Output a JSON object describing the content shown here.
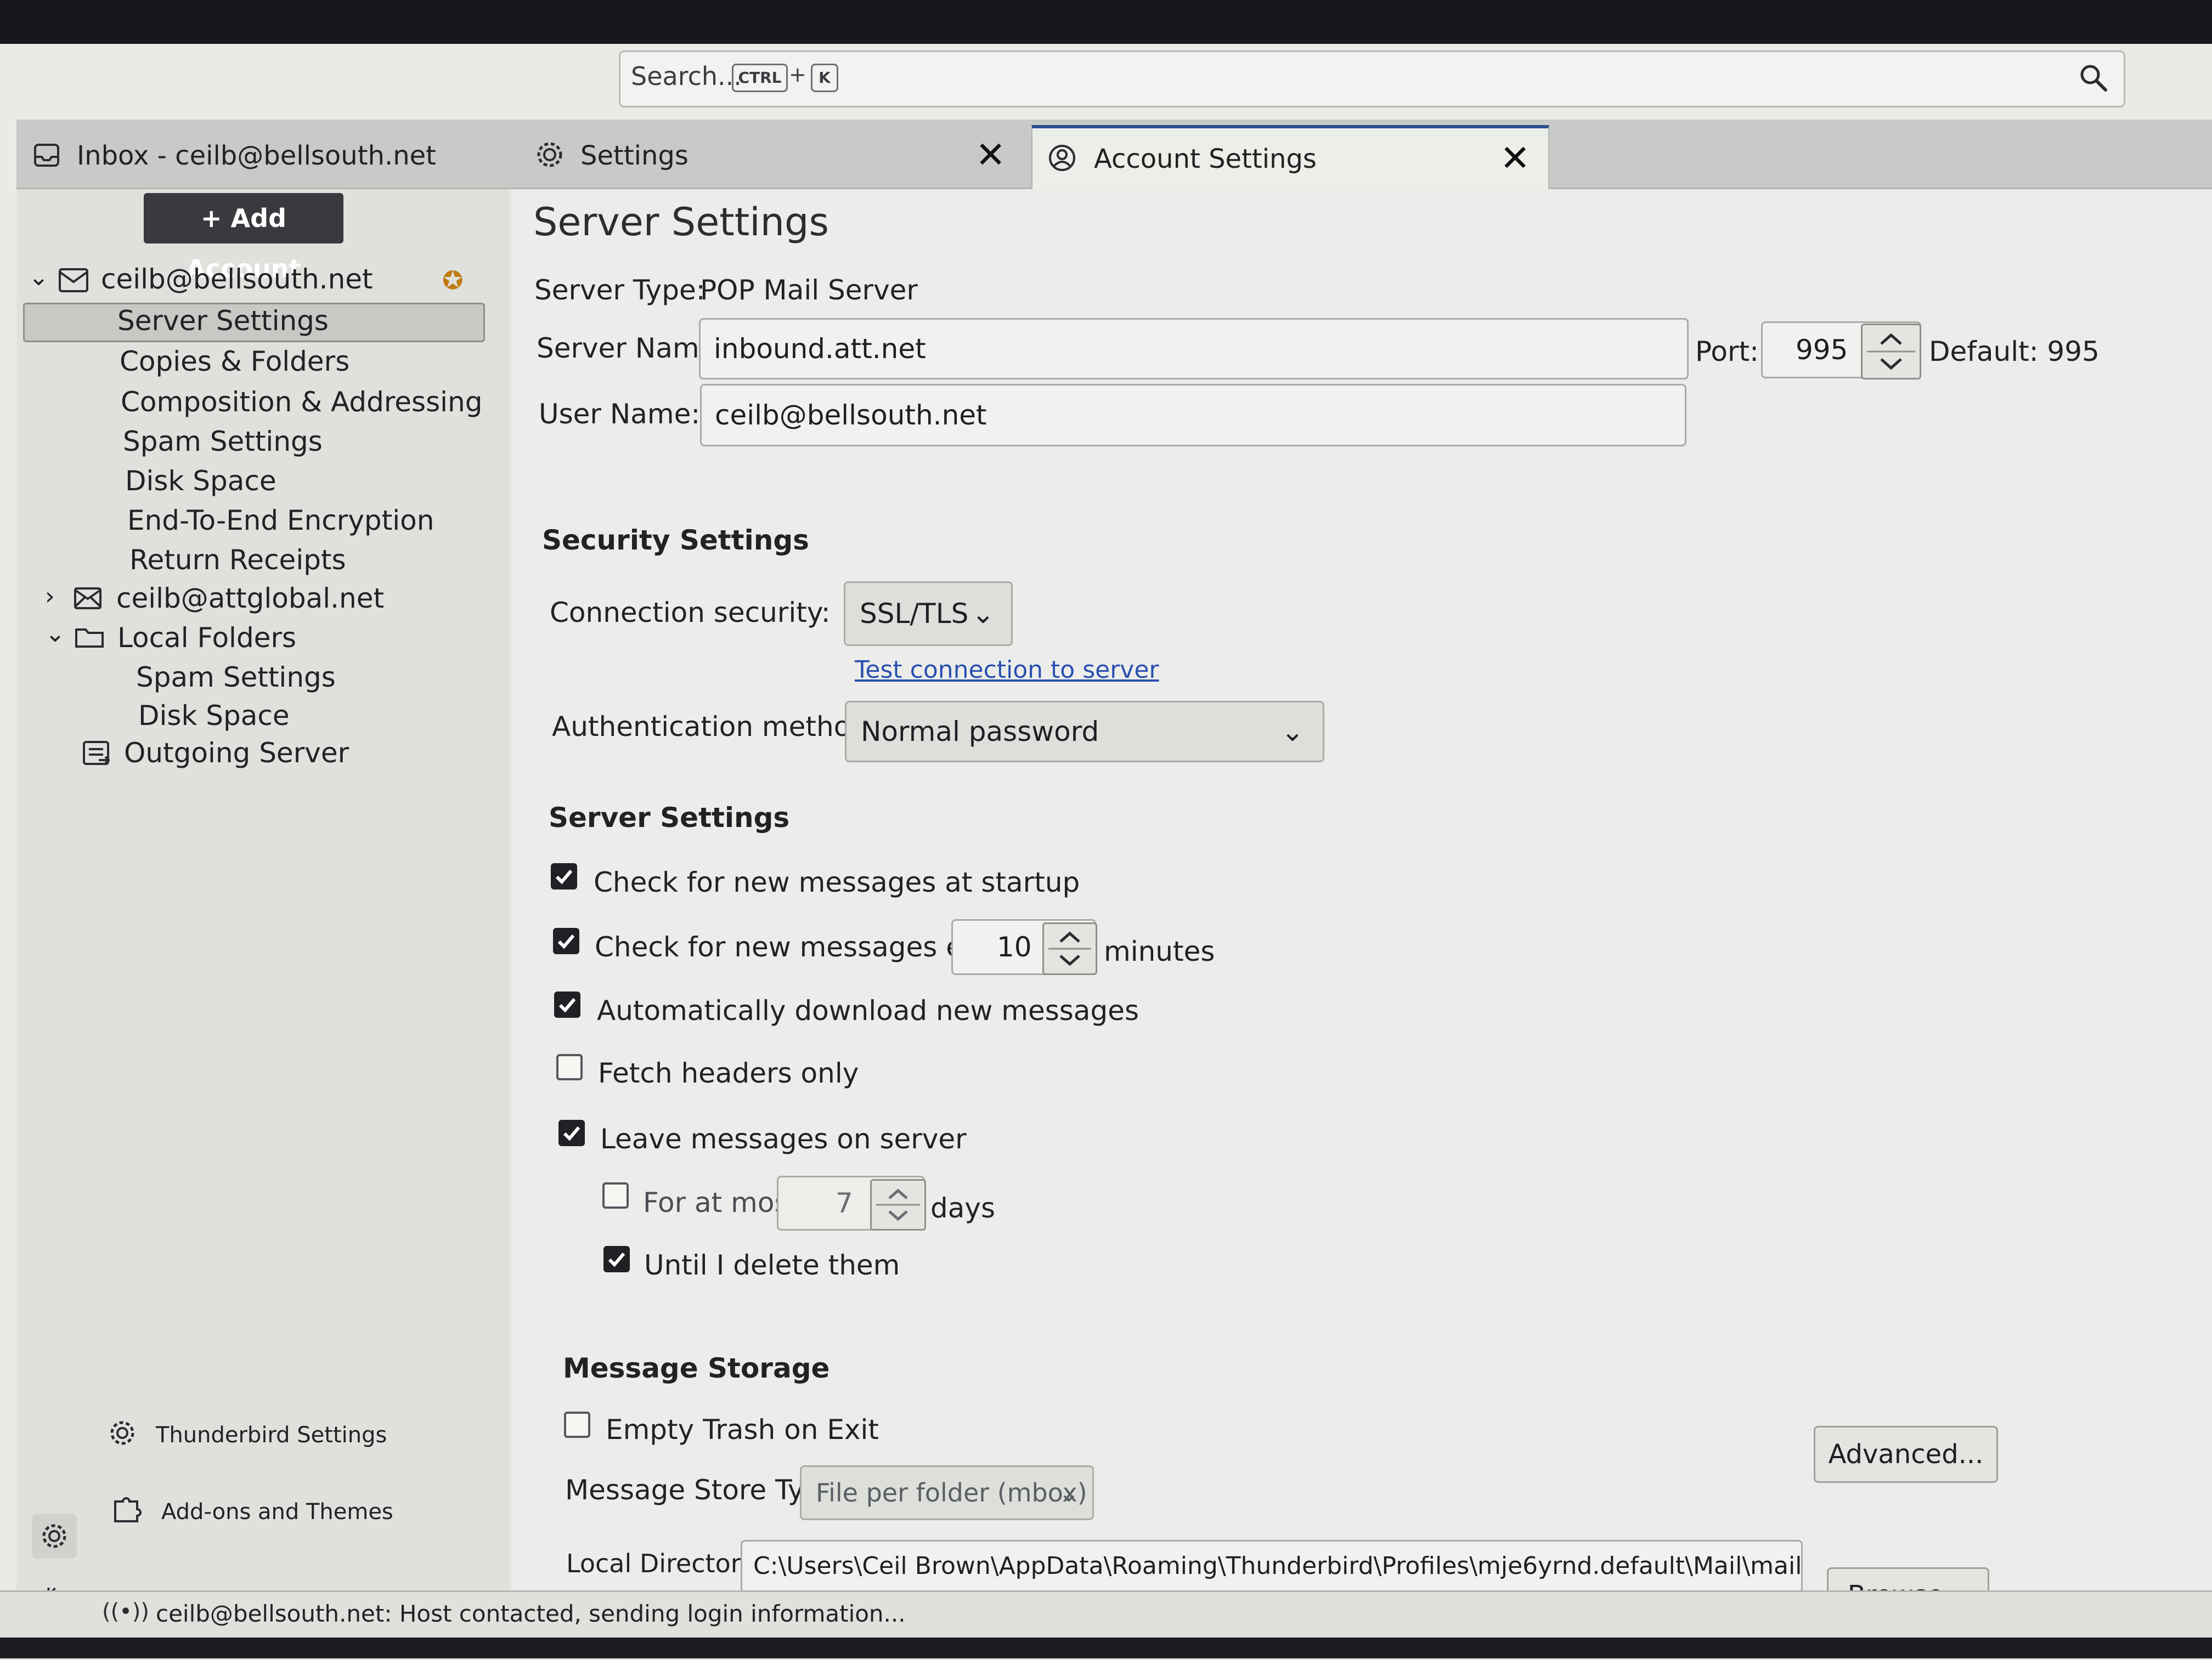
{
  "search": {
    "placeholder": "Search...",
    "key1": "CTRL",
    "plus": "+",
    "key2": "K"
  },
  "tabs": [
    {
      "label": "Inbox - ceilb@bellsouth.net",
      "icon": "inbox-icon"
    },
    {
      "label": "Settings",
      "icon": "gear-icon"
    },
    {
      "label": "Account Settings",
      "icon": "account-settings-icon",
      "active": true
    }
  ],
  "sidebar": {
    "add_account": "Add Account",
    "accounts": [
      {
        "label": "ceilb@bellsouth.net",
        "expanded": true,
        "default": true,
        "children": [
          "Server Settings",
          "Copies & Folders",
          "Composition & Addressing",
          "Spam Settings",
          "Disk Space",
          "End-To-End Encryption",
          "Return Receipts"
        ]
      },
      {
        "label": "ceilb@attglobal.net",
        "expanded": false
      },
      {
        "label": "Local Folders",
        "expanded": true,
        "children": [
          "Spam Settings",
          "Disk Space"
        ]
      },
      {
        "label": "Outgoing Server"
      }
    ],
    "selected": "Server Settings",
    "bottom": {
      "tb_settings": "Thunderbird Settings",
      "addons": "Add-ons and Themes"
    }
  },
  "page": {
    "title": "Server Settings",
    "server_type_label": "Server Type:",
    "server_type_value": "POP Mail Server",
    "server_name_label": "Server Name:",
    "server_name_value": "inbound.att.net",
    "port_label": "Port:",
    "port_value": "995",
    "default_port": "Default: 995",
    "user_name_label": "User Name:",
    "user_name_value": "ceilb@bellsouth.net"
  },
  "security": {
    "heading": "Security Settings",
    "conn_label": "Connection security:",
    "conn_value": "SSL/TLS",
    "test_link": "Test connection to server",
    "auth_label": "Authentication method:",
    "auth_value": "Normal password"
  },
  "server_settings": {
    "heading": "Server Settings",
    "check_startup": {
      "label": "Check for new messages at startup",
      "checked": true
    },
    "check_every": {
      "label": "Check for new messages every",
      "checked": true,
      "value": "10",
      "unit": "minutes"
    },
    "auto_download": {
      "label": "Automatically download new messages",
      "checked": true
    },
    "headers_only": {
      "label": "Fetch headers only",
      "checked": false
    },
    "leave_on_server": {
      "label": "Leave messages on server",
      "checked": true
    },
    "for_at_most": {
      "label": "For at most",
      "checked": false,
      "value": "7",
      "unit": "days"
    },
    "until_delete": {
      "label": "Until I delete them",
      "checked": true
    }
  },
  "storage": {
    "heading": "Message Storage",
    "empty_trash": {
      "label": "Empty Trash on Exit",
      "checked": false
    },
    "advanced_button": "Advanced...",
    "store_type_label": "Message Store Type:",
    "store_type_value": "File per folder (mbox)",
    "local_dir_label": "Local Directory:",
    "local_dir_value": "C:\\Users\\Ceil Brown\\AppData\\Roaming\\Thunderbird\\Profiles\\mje6yrnd.default\\Mail\\mail.bellsc",
    "browse_button": "Browse..."
  },
  "status": {
    "text": "ceilb@bellsouth.net: Host contacted, sending login information..."
  }
}
